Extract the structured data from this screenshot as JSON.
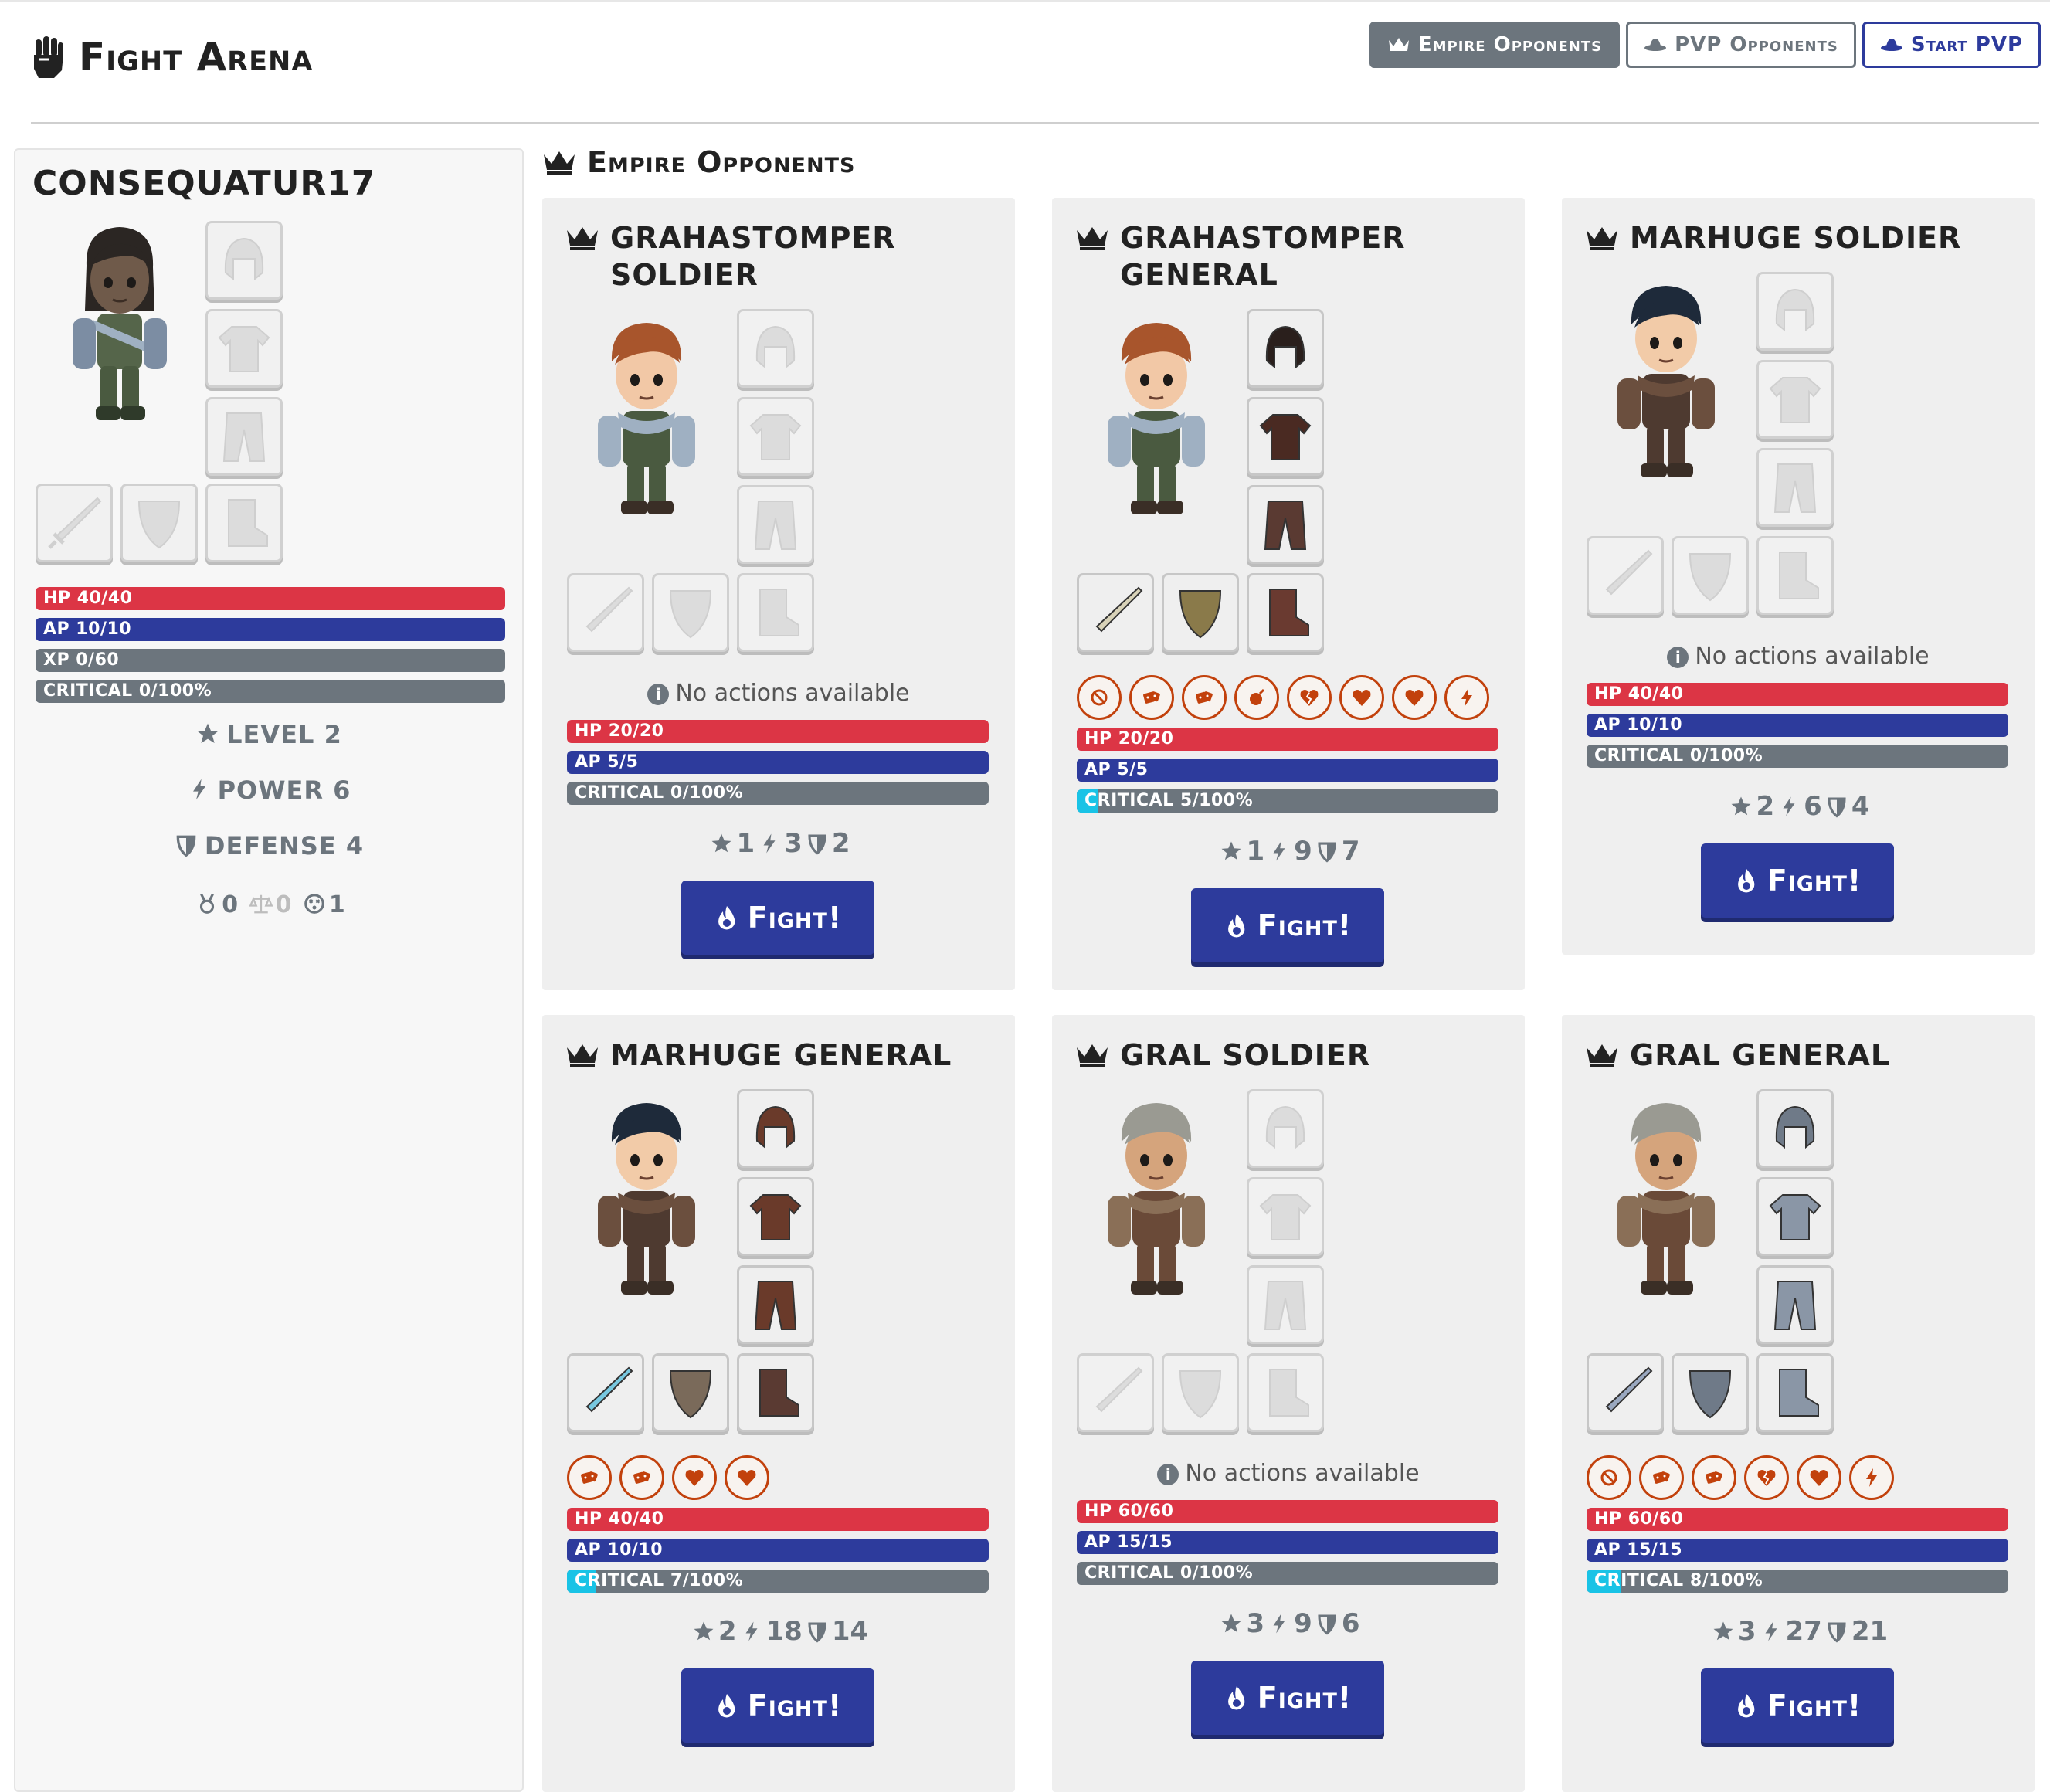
{
  "header": {
    "title": "Fight Arena",
    "buttons": {
      "empire": "Empire Opponents",
      "pvp": "PVP Opponents",
      "start_pvp": "Start PVP"
    }
  },
  "player": {
    "name": "CONSEQUATUR17",
    "bars": {
      "hp": "HP 40/40",
      "ap": "AP 10/10",
      "xp": "XP 0/60",
      "crit": "CRITICAL 0/100%"
    },
    "level": "LEVEL 2",
    "power": "POWER 6",
    "defense": "DEFENSE 4",
    "medals": [
      "0",
      "0",
      "1"
    ]
  },
  "section_title": "Empire Opponents",
  "no_actions_text": "No actions available",
  "fight_label": "Fight!",
  "opponents": [
    {
      "name": "GRAHASTOMPER SOLDIER",
      "hp": "HP 20/20",
      "ap": "AP 5/5",
      "crit": "CRITICAL 0/100%",
      "crit_pct": 0,
      "level": "1",
      "power": "3",
      "defense": "2",
      "actions": []
    },
    {
      "name": "GRAHASTOMPER GENERAL",
      "hp": "HP 20/20",
      "ap": "AP 5/5",
      "crit": "CRITICAL 5/100%",
      "crit_pct": 5,
      "level": "1",
      "power": "9",
      "defense": "7",
      "actions": [
        "block",
        "dice",
        "dice",
        "bomb",
        "broken-heart",
        "heart",
        "heart",
        "bolt"
      ]
    },
    {
      "name": "MARHUGE SOLDIER",
      "hp": "HP 40/40",
      "ap": "AP 10/10",
      "crit": "CRITICAL 0/100%",
      "crit_pct": 0,
      "level": "2",
      "power": "6",
      "defense": "4",
      "actions": []
    },
    {
      "name": "MARHUGE GENERAL",
      "hp": "HP 40/40",
      "ap": "AP 10/10",
      "crit": "CRITICAL 7/100%",
      "crit_pct": 7,
      "level": "2",
      "power": "18",
      "defense": "14",
      "actions": [
        "dice",
        "dice",
        "heart",
        "heart"
      ]
    },
    {
      "name": "GRAL SOLDIER",
      "hp": "HP 60/60",
      "ap": "AP 15/15",
      "crit": "CRITICAL 0/100%",
      "crit_pct": 0,
      "level": "3",
      "power": "9",
      "defense": "6",
      "actions": []
    },
    {
      "name": "GRAL GENERAL",
      "hp": "HP 60/60",
      "ap": "AP 15/15",
      "crit": "CRITICAL 8/100%",
      "crit_pct": 8,
      "level": "3",
      "power": "27",
      "defense": "21",
      "actions": [
        "block",
        "dice",
        "dice",
        "broken-heart",
        "heart",
        "bolt"
      ]
    }
  ],
  "colors": {
    "primary": "#2d3b9c",
    "danger": "#dc3545",
    "secondary": "#6c757d",
    "critical_fill": "#19c3e6",
    "action_ring": "#c2410c"
  }
}
